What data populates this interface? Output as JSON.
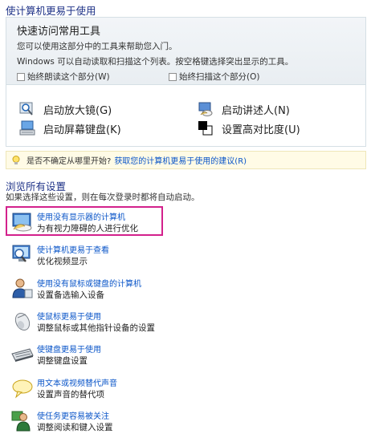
{
  "header": {
    "title": "使计算机更易于使用"
  },
  "quick_access": {
    "title": "快速访问常用工具",
    "line1": "您可以使用这部分中的工具来帮助您入门。",
    "line2": "Windows 可以自动读取和扫描这个列表。按空格键选择突出显示的工具。",
    "checkbox_read": {
      "label": "始终朗读这个部分(W)",
      "checked": false
    },
    "checkbox_scan": {
      "label": "始终扫描这个部分(O)",
      "checked": false
    },
    "tools": [
      {
        "label": "启动放大镜(G)",
        "icon": "magnifier-icon"
      },
      {
        "label": "启动讲述人(N)",
        "icon": "narrator-icon"
      },
      {
        "label": "启动屏幕键盘(K)",
        "icon": "on-screen-keyboard-icon"
      },
      {
        "label": "设置高对比度(U)",
        "icon": "high-contrast-icon"
      }
    ]
  },
  "tip": {
    "text": "是否不确定从哪里开始?",
    "link": "获取您的计算机更易于使用的建议(R)"
  },
  "browse": {
    "title": "浏览所有设置",
    "subtitle": "如果选择这些设置，则在每次登录时都将自动启动。",
    "items": [
      {
        "link": "使用没有显示器的计算机",
        "desc": "为有视力障碍的人进行优化",
        "icon": "monitor-speech-icon"
      },
      {
        "link": "使计算机更易于查看",
        "desc": "优化视频显示",
        "icon": "monitor-magnify-icon"
      },
      {
        "link": "使用没有鼠标或键盘的计算机",
        "desc": "设置备选输入设备",
        "icon": "user-icon"
      },
      {
        "link": "使鼠标更易于使用",
        "desc": "调整鼠标或其他指针设备的设置",
        "icon": "mouse-icon"
      },
      {
        "link": "使键盘更易于使用",
        "desc": "调整键盘设置",
        "icon": "keyboard-icon"
      },
      {
        "link": "用文本或视频替代声音",
        "desc": "设置声音的替代项",
        "icon": "speech-bubble-icon"
      },
      {
        "link": "使任务更容易被关注",
        "desc": "调整阅读和键入设置",
        "icon": "users-focus-icon"
      }
    ]
  },
  "colors": {
    "link": "#0a55c8",
    "title": "#1e3287",
    "highlight": "#d3218c",
    "tip_bg": "#fffbe6"
  }
}
